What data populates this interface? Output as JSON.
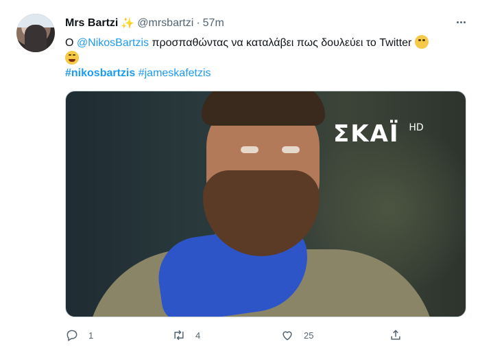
{
  "tweet": {
    "author_name": "Mrs Bartzi",
    "name_emoji": "✨",
    "handle": "@mrsbartzi",
    "separator": "·",
    "time": "57m",
    "text_prefix": "Ο ",
    "mention": "@NikosBartzis",
    "text_body": " προσπαθώντας να καταλάβει πως δουλεύει το Twitter",
    "hashtags": [
      "#nikosbartzis",
      "#jameskafetzis"
    ]
  },
  "media": {
    "channel_logo": "ΣΚΑΪ",
    "channel_suffix": "HD"
  },
  "actions": {
    "reply_count": "1",
    "retweet_count": "4",
    "like_count": "25"
  },
  "icons": {
    "reply": "reply-icon",
    "retweet": "retweet-icon",
    "like": "heart-icon",
    "share": "share-icon",
    "more": "more-icon"
  },
  "colors": {
    "link": "#1d9bf0",
    "muted": "#536471",
    "text": "#0f1419"
  }
}
